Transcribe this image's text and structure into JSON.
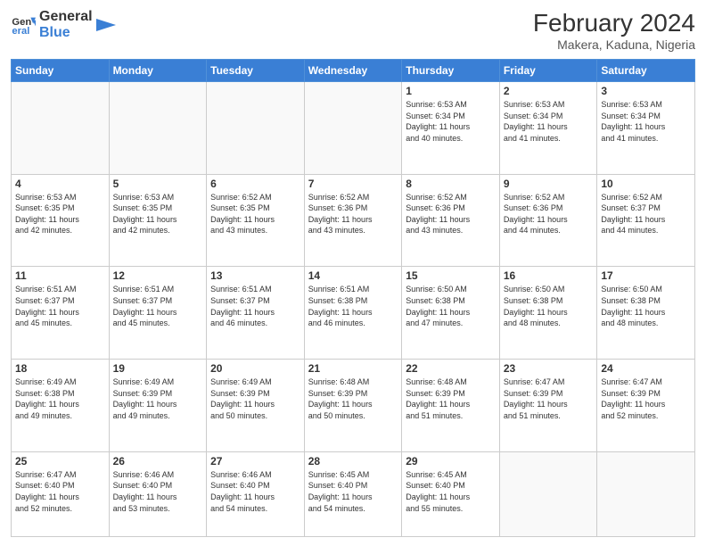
{
  "header": {
    "logo_line1": "General",
    "logo_line2": "Blue",
    "title": "February 2024",
    "location": "Makera, Kaduna, Nigeria"
  },
  "weekdays": [
    "Sunday",
    "Monday",
    "Tuesday",
    "Wednesday",
    "Thursday",
    "Friday",
    "Saturday"
  ],
  "weeks": [
    [
      {
        "day": "",
        "info": ""
      },
      {
        "day": "",
        "info": ""
      },
      {
        "day": "",
        "info": ""
      },
      {
        "day": "",
        "info": ""
      },
      {
        "day": "1",
        "info": "Sunrise: 6:53 AM\nSunset: 6:34 PM\nDaylight: 11 hours\nand 40 minutes."
      },
      {
        "day": "2",
        "info": "Sunrise: 6:53 AM\nSunset: 6:34 PM\nDaylight: 11 hours\nand 41 minutes."
      },
      {
        "day": "3",
        "info": "Sunrise: 6:53 AM\nSunset: 6:34 PM\nDaylight: 11 hours\nand 41 minutes."
      }
    ],
    [
      {
        "day": "4",
        "info": "Sunrise: 6:53 AM\nSunset: 6:35 PM\nDaylight: 11 hours\nand 42 minutes."
      },
      {
        "day": "5",
        "info": "Sunrise: 6:53 AM\nSunset: 6:35 PM\nDaylight: 11 hours\nand 42 minutes."
      },
      {
        "day": "6",
        "info": "Sunrise: 6:52 AM\nSunset: 6:35 PM\nDaylight: 11 hours\nand 43 minutes."
      },
      {
        "day": "7",
        "info": "Sunrise: 6:52 AM\nSunset: 6:36 PM\nDaylight: 11 hours\nand 43 minutes."
      },
      {
        "day": "8",
        "info": "Sunrise: 6:52 AM\nSunset: 6:36 PM\nDaylight: 11 hours\nand 43 minutes."
      },
      {
        "day": "9",
        "info": "Sunrise: 6:52 AM\nSunset: 6:36 PM\nDaylight: 11 hours\nand 44 minutes."
      },
      {
        "day": "10",
        "info": "Sunrise: 6:52 AM\nSunset: 6:37 PM\nDaylight: 11 hours\nand 44 minutes."
      }
    ],
    [
      {
        "day": "11",
        "info": "Sunrise: 6:51 AM\nSunset: 6:37 PM\nDaylight: 11 hours\nand 45 minutes."
      },
      {
        "day": "12",
        "info": "Sunrise: 6:51 AM\nSunset: 6:37 PM\nDaylight: 11 hours\nand 45 minutes."
      },
      {
        "day": "13",
        "info": "Sunrise: 6:51 AM\nSunset: 6:37 PM\nDaylight: 11 hours\nand 46 minutes."
      },
      {
        "day": "14",
        "info": "Sunrise: 6:51 AM\nSunset: 6:38 PM\nDaylight: 11 hours\nand 46 minutes."
      },
      {
        "day": "15",
        "info": "Sunrise: 6:50 AM\nSunset: 6:38 PM\nDaylight: 11 hours\nand 47 minutes."
      },
      {
        "day": "16",
        "info": "Sunrise: 6:50 AM\nSunset: 6:38 PM\nDaylight: 11 hours\nand 48 minutes."
      },
      {
        "day": "17",
        "info": "Sunrise: 6:50 AM\nSunset: 6:38 PM\nDaylight: 11 hours\nand 48 minutes."
      }
    ],
    [
      {
        "day": "18",
        "info": "Sunrise: 6:49 AM\nSunset: 6:38 PM\nDaylight: 11 hours\nand 49 minutes."
      },
      {
        "day": "19",
        "info": "Sunrise: 6:49 AM\nSunset: 6:39 PM\nDaylight: 11 hours\nand 49 minutes."
      },
      {
        "day": "20",
        "info": "Sunrise: 6:49 AM\nSunset: 6:39 PM\nDaylight: 11 hours\nand 50 minutes."
      },
      {
        "day": "21",
        "info": "Sunrise: 6:48 AM\nSunset: 6:39 PM\nDaylight: 11 hours\nand 50 minutes."
      },
      {
        "day": "22",
        "info": "Sunrise: 6:48 AM\nSunset: 6:39 PM\nDaylight: 11 hours\nand 51 minutes."
      },
      {
        "day": "23",
        "info": "Sunrise: 6:47 AM\nSunset: 6:39 PM\nDaylight: 11 hours\nand 51 minutes."
      },
      {
        "day": "24",
        "info": "Sunrise: 6:47 AM\nSunset: 6:39 PM\nDaylight: 11 hours\nand 52 minutes."
      }
    ],
    [
      {
        "day": "25",
        "info": "Sunrise: 6:47 AM\nSunset: 6:40 PM\nDaylight: 11 hours\nand 52 minutes."
      },
      {
        "day": "26",
        "info": "Sunrise: 6:46 AM\nSunset: 6:40 PM\nDaylight: 11 hours\nand 53 minutes."
      },
      {
        "day": "27",
        "info": "Sunrise: 6:46 AM\nSunset: 6:40 PM\nDaylight: 11 hours\nand 54 minutes."
      },
      {
        "day": "28",
        "info": "Sunrise: 6:45 AM\nSunset: 6:40 PM\nDaylight: 11 hours\nand 54 minutes."
      },
      {
        "day": "29",
        "info": "Sunrise: 6:45 AM\nSunset: 6:40 PM\nDaylight: 11 hours\nand 55 minutes."
      },
      {
        "day": "",
        "info": ""
      },
      {
        "day": "",
        "info": ""
      }
    ]
  ]
}
